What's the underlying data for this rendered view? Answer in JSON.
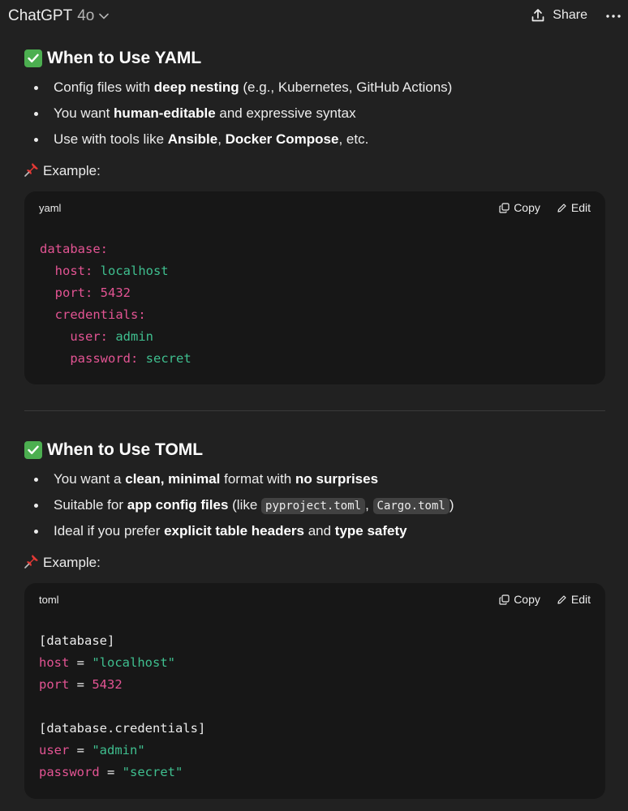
{
  "header": {
    "model_name": "ChatGPT",
    "model_version": "4o",
    "share_label": "Share"
  },
  "yaml_section": {
    "title": "When to Use YAML",
    "bullets": [
      [
        {
          "t": "Config files with "
        },
        {
          "t": "deep nesting",
          "b": true
        },
        {
          "t": " (e.g., Kubernetes, GitHub Actions)"
        }
      ],
      [
        {
          "t": "You want "
        },
        {
          "t": "human-editable",
          "b": true
        },
        {
          "t": " and expressive syntax"
        }
      ],
      [
        {
          "t": "Use with tools like "
        },
        {
          "t": "Ansible",
          "b": true
        },
        {
          "t": ", "
        },
        {
          "t": "Docker Compose",
          "b": true
        },
        {
          "t": ", etc."
        }
      ]
    ],
    "example_label": "Example:",
    "code": {
      "lang": "yaml",
      "copy_label": "Copy",
      "edit_label": "Edit",
      "lines": [
        [
          {
            "t": "database:",
            "c": "k"
          }
        ],
        [
          {
            "t": "  host: ",
            "c": "k"
          },
          {
            "t": "localhost",
            "c": "v"
          }
        ],
        [
          {
            "t": "  port: ",
            "c": "k"
          },
          {
            "t": "5432",
            "c": "k"
          }
        ],
        [
          {
            "t": "  credentials:",
            "c": "k"
          }
        ],
        [
          {
            "t": "    user: ",
            "c": "k"
          },
          {
            "t": "admin",
            "c": "v"
          }
        ],
        [
          {
            "t": "    password: ",
            "c": "k"
          },
          {
            "t": "secret",
            "c": "v"
          }
        ]
      ]
    }
  },
  "toml_section": {
    "title": "When to Use TOML",
    "bullets": [
      [
        {
          "t": "You want a "
        },
        {
          "t": "clean, minimal",
          "b": true
        },
        {
          "t": " format with "
        },
        {
          "t": "no surprises",
          "b": true
        }
      ],
      [
        {
          "t": "Suitable for "
        },
        {
          "t": "app config files",
          "b": true
        },
        {
          "t": " (like "
        },
        {
          "t": "pyproject.toml",
          "code": true
        },
        {
          "t": ", "
        },
        {
          "t": "Cargo.toml",
          "code": true
        },
        {
          "t": ")"
        }
      ],
      [
        {
          "t": "Ideal if you prefer "
        },
        {
          "t": "explicit table headers",
          "b": true
        },
        {
          "t": " and "
        },
        {
          "t": "type safety",
          "b": true
        }
      ]
    ],
    "example_label": "Example:",
    "code": {
      "lang": "toml",
      "copy_label": "Copy",
      "edit_label": "Edit",
      "lines": [
        [
          {
            "t": "[database]",
            "c": "p"
          }
        ],
        [
          {
            "t": "host",
            "c": "k"
          },
          {
            "t": " = ",
            "c": "p"
          },
          {
            "t": "\"localhost\"",
            "c": "v"
          }
        ],
        [
          {
            "t": "port",
            "c": "k"
          },
          {
            "t": " = ",
            "c": "p"
          },
          {
            "t": "5432",
            "c": "k"
          }
        ],
        [
          {
            "t": "",
            "c": "p"
          }
        ],
        [
          {
            "t": "[database.credentials]",
            "c": "p"
          }
        ],
        [
          {
            "t": "user",
            "c": "k"
          },
          {
            "t": " = ",
            "c": "p"
          },
          {
            "t": "\"admin\"",
            "c": "v"
          }
        ],
        [
          {
            "t": "password",
            "c": "k"
          },
          {
            "t": " = ",
            "c": "p"
          },
          {
            "t": "\"secret\"",
            "c": "v"
          }
        ]
      ]
    }
  },
  "icons": {
    "check": "check-mark-icon",
    "pin": "pushpin-icon",
    "share": "share-upload-icon",
    "more": "more-dots-icon",
    "copy": "copy-icon",
    "edit": "edit-pencil-icon",
    "chevron": "chevron-down-icon"
  },
  "colors": {
    "bg": "#212121",
    "code_bg": "#171717",
    "key": "#e35493",
    "value": "#3fbf8f",
    "check": "#4caf50"
  }
}
